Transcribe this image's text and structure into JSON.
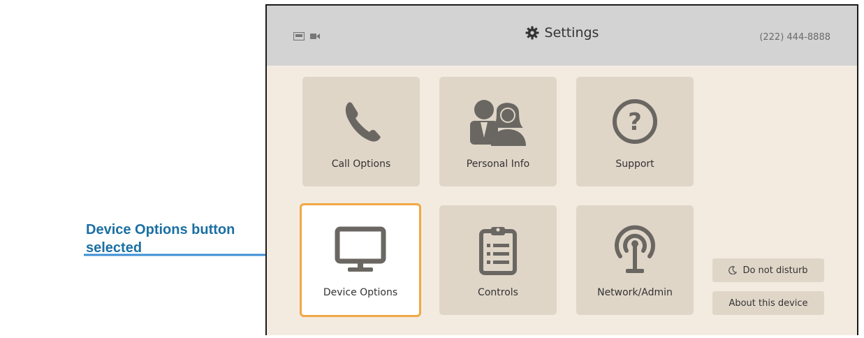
{
  "annotation": {
    "line1": "Device Options button",
    "line2": "selected"
  },
  "header": {
    "title": "Settings",
    "phone": "(222) 444-8888",
    "status_icons": [
      "ethernet-icon",
      "camera-icon"
    ],
    "title_icon": "gear-icon"
  },
  "tiles": {
    "call_options": {
      "label": "Call Options",
      "icon": "phone-icon"
    },
    "personal_info": {
      "label": "Personal Info",
      "icon": "people-icon"
    },
    "support": {
      "label": "Support",
      "icon": "question-icon"
    },
    "device_options": {
      "label": "Device Options",
      "icon": "monitor-icon",
      "selected": true
    },
    "controls": {
      "label": "Controls",
      "icon": "clipboard-icon"
    },
    "network_admin": {
      "label": "Network/Admin",
      "icon": "antenna-icon"
    }
  },
  "side_buttons": {
    "do_not_disturb": "Do not disturb",
    "about": "About this device"
  },
  "colors": {
    "background": "#f4ebe0",
    "header": "#d3d3d3",
    "tile": "#e0d6c8",
    "icon": "#6a6763",
    "selected_border": "#f0a844",
    "annotation": "#1b6fa3"
  }
}
